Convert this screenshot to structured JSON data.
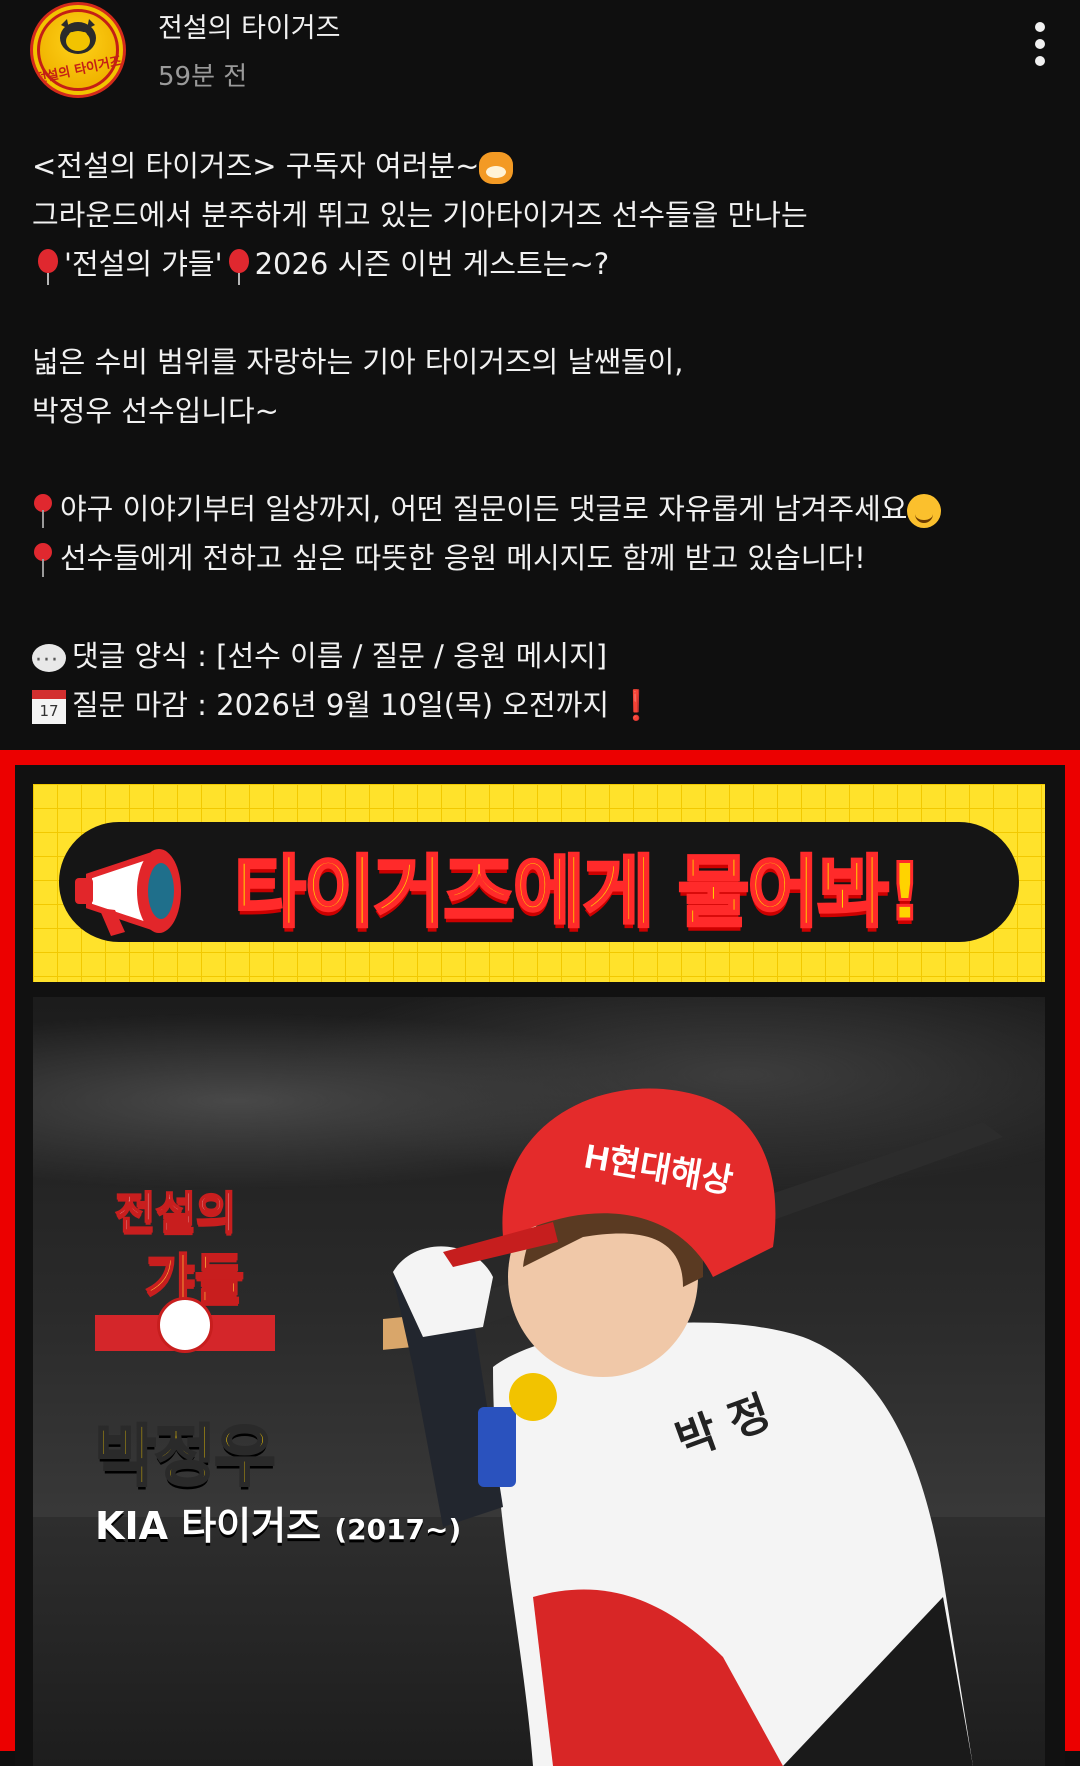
{
  "post": {
    "channel_name": "전설의 타이거즈",
    "avatar_text": "전설의 타이거즈",
    "time": "59분 전"
  },
  "body": {
    "line1_pre": "<전설의 타이거즈> 구독자 여러분~",
    "line2": "그라운드에서 분주하게 뛰고 있는 기아타이거즈 선수들을 만나는",
    "line3_mid": "'전설의 갸들'",
    "line3_post": "2026 시즌 이번 게스트는~?",
    "line4": "넓은 수비 범위를 자랑하는 기아 타이거즈의 날쌘돌이,",
    "line5": "박정우 선수입니다~",
    "line6": "야구 이야기부터 일상까지, 어떤 질문이든 댓글로 자유롭게 남겨주세요",
    "line7": "선수들에게 전하고 싶은 따뜻한 응원 메시지도 함께 받고 있습니다!",
    "line8": "댓글 양식 : [선수 이름 / 질문 / 응원 메시지]",
    "line9": "질문 마감 : 2026년 9월 10일(목) 오전까지",
    "calendar_day": "17",
    "exclamation": "❗"
  },
  "image": {
    "banner_title": "타이거즈에게 물어봐!",
    "badge_line1": "전설의",
    "badge_line2": "갸들",
    "player_name": "박정우",
    "team": "KIA 타이거즈",
    "team_years": "(2017~)",
    "helmet_sponsor": "H현대해상",
    "jersey_name": "박 정"
  },
  "colors": {
    "background": "#0f0f0f",
    "frame_red": "#ec0000",
    "banner_yellow": "#ffe22b"
  },
  "icons": [
    "tiger-avatar-icon",
    "more-vert-icon",
    "tiger-emoji-icon",
    "balloon-icon",
    "pin-icon",
    "smile-emoji-icon",
    "speech-bubble-icon",
    "calendar-icon",
    "megaphone-icon"
  ]
}
